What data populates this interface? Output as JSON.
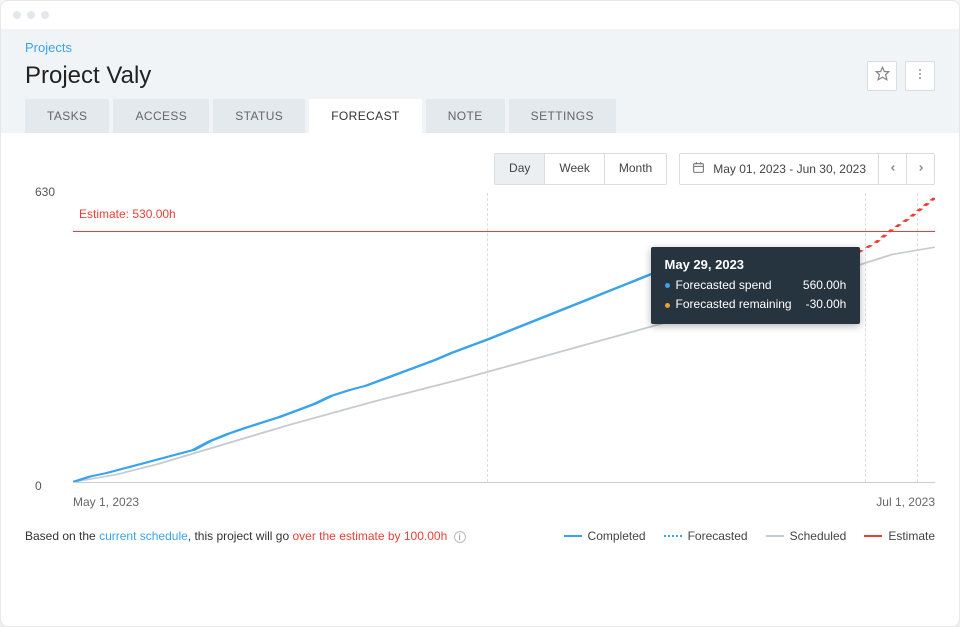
{
  "breadcrumb": "Projects",
  "title": "Project Valy",
  "tabs": [
    {
      "label": "TASKS",
      "active": false
    },
    {
      "label": "ACCESS",
      "active": false
    },
    {
      "label": "STATUS",
      "active": false
    },
    {
      "label": "FORECAST",
      "active": true
    },
    {
      "label": "NOTE",
      "active": false
    },
    {
      "label": "SETTINGS",
      "active": false
    }
  ],
  "granularity": {
    "options": [
      "Day",
      "Week",
      "Month"
    ],
    "active": "Day"
  },
  "date_range": "May 01, 2023 - Jun 30, 2023",
  "chart_data": {
    "type": "line",
    "xlabel_start": "May 1, 2023",
    "xlabel_end": "Jul 1, 2023",
    "ylim": [
      0,
      630
    ],
    "ytick_top": "630",
    "ytick_bottom": "0",
    "estimate_label": "Estimate: 530.00h",
    "series": [
      {
        "name": "Completed",
        "color": "#3aa3ea",
        "style": "solid"
      },
      {
        "name": "Forecasted",
        "color": "#3aa3ea",
        "style": "dotted"
      },
      {
        "name": "Scheduled",
        "color": "#c6cbd1",
        "style": "solid"
      },
      {
        "name": "Estimate",
        "color": "#ea3f35",
        "style": "solid"
      }
    ],
    "completed_x": [
      0,
      2,
      4,
      6,
      8,
      10,
      12,
      14,
      16,
      18,
      20,
      22,
      24,
      26,
      28,
      30,
      32,
      34,
      36,
      38,
      40,
      42,
      44,
      46,
      48,
      50,
      52,
      54,
      56,
      58,
      60,
      62,
      64,
      66,
      68,
      70,
      72
    ],
    "completed_y": [
      0,
      12,
      20,
      30,
      40,
      50,
      60,
      70,
      90,
      105,
      118,
      130,
      142,
      156,
      170,
      188,
      200,
      210,
      224,
      238,
      252,
      266,
      282,
      296,
      310,
      325,
      340,
      355,
      370,
      385,
      400,
      415,
      430,
      445,
      460,
      475,
      480
    ],
    "scheduled_x": [
      0,
      5,
      10,
      15,
      20,
      25,
      30,
      35,
      40,
      45,
      50,
      55,
      60,
      65,
      70,
      75,
      80,
      85,
      90,
      95,
      100
    ],
    "scheduled_y": [
      0,
      16,
      40,
      68,
      96,
      124,
      150,
      176,
      200,
      224,
      250,
      276,
      302,
      328,
      354,
      380,
      408,
      436,
      466,
      496,
      512
    ],
    "forecasted_x": [
      91,
      93,
      95,
      97,
      99,
      100
    ],
    "forecasted_y": [
      500,
      520,
      550,
      575,
      605,
      620
    ]
  },
  "tooltip": {
    "date": "May 29, 2023",
    "rows": [
      {
        "label": "Forecasted spend",
        "value": "560.00h",
        "color": "#3aa3ea"
      },
      {
        "label": "Forecasted remaining",
        "value": "-30.00h",
        "color": "#e1a23b"
      }
    ]
  },
  "message": {
    "prefix": "Based on the ",
    "link": "current schedule",
    "mid": ", this project will go ",
    "warn": "over the estimate by 100.00h"
  },
  "legend": {
    "completed": "Completed",
    "forecasted": "Forecasted",
    "scheduled": "Scheduled",
    "estimate": "Estimate"
  }
}
